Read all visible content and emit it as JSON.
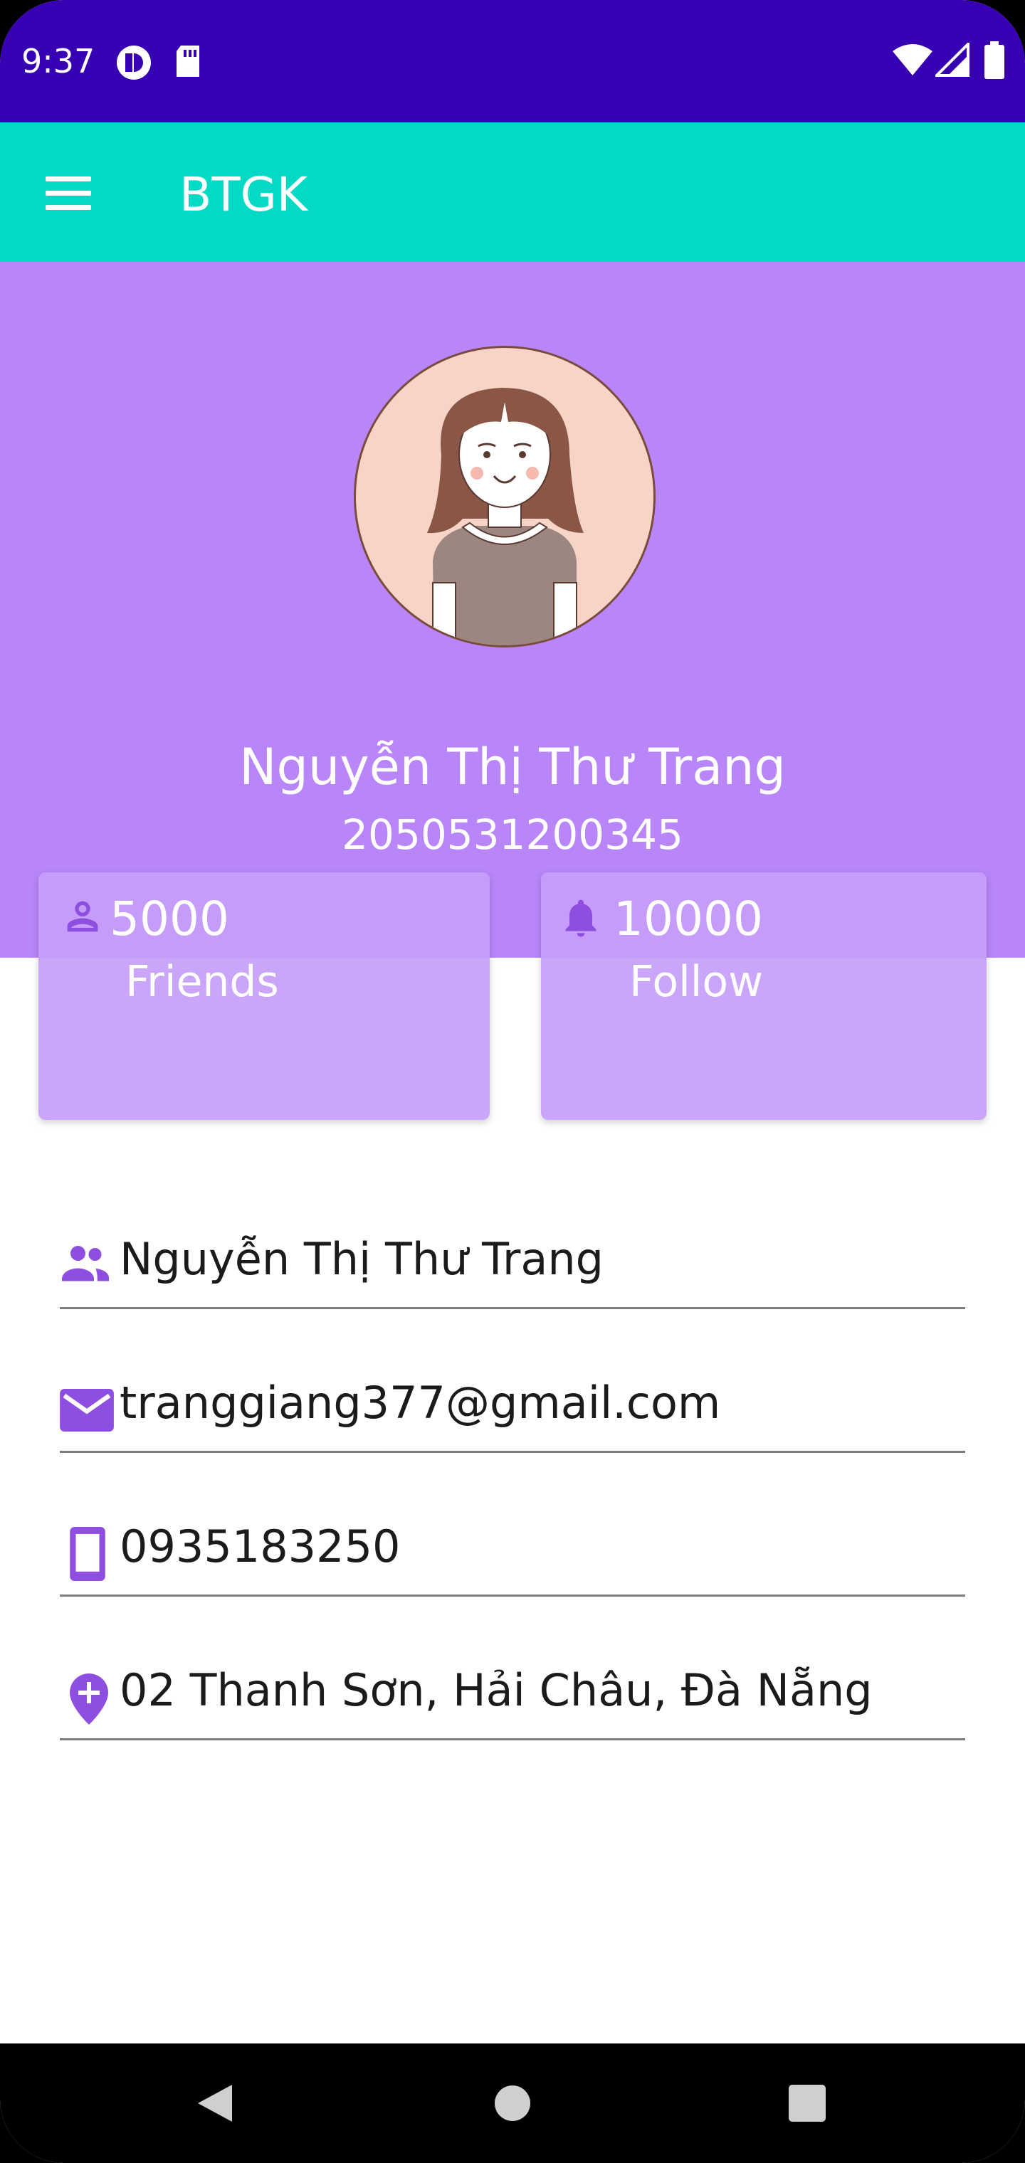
{
  "status_bar": {
    "time": "9:37",
    "left_icons": [
      "vpn-key-icon",
      "sd-card-icon"
    ],
    "right_icons": [
      "wifi-icon",
      "cell-signal-icon",
      "battery-icon"
    ]
  },
  "app_bar": {
    "title": "BTGK",
    "menu_icon": "hamburger-menu-icon"
  },
  "profile": {
    "name": "Nguyễn Thị Thư Trang",
    "student_id": "2050531200345",
    "avatar": "female-avatar-illustration"
  },
  "stats": [
    {
      "icon": "person-icon",
      "value": "5000",
      "label": "Friends"
    },
    {
      "icon": "bell-icon",
      "value": "10000",
      "label": "Follow"
    }
  ],
  "fields": [
    {
      "icon": "people-icon",
      "value": "Nguyễn Thị Thư Trang"
    },
    {
      "icon": "email-icon",
      "value": "tranggiang377@gmail.com"
    },
    {
      "icon": "phone-icon",
      "value": "0935183250"
    },
    {
      "icon": "location-icon",
      "value": "02 Thanh Sơn, Hải Châu, Đà Nẵng"
    }
  ],
  "nav_bar": {
    "buttons": [
      "back-icon",
      "home-icon",
      "recents-icon"
    ]
  },
  "colors": {
    "status_bar": "#3700B3",
    "app_bar": "#03DAC5",
    "header": "#B886F8",
    "card": "#C69EFA",
    "icon_purple": "#8E4FE0"
  }
}
